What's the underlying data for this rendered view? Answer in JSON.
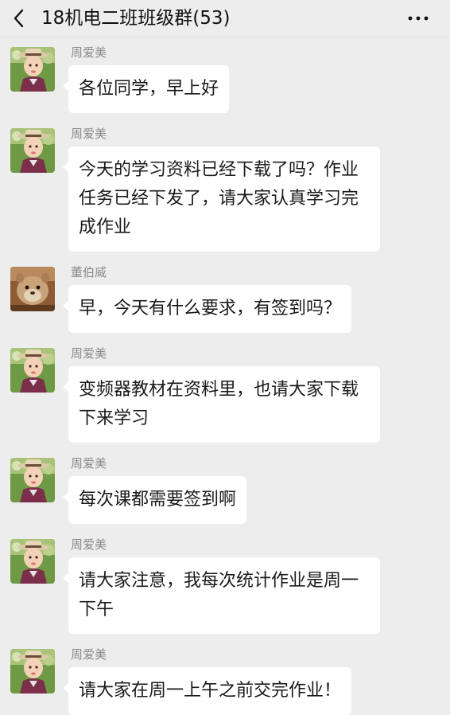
{
  "header": {
    "title": "18机电二班班级群(53)"
  },
  "messages": [
    {
      "sender": "周爱美",
      "avatar": "zhou-avatar",
      "text": "各位同学，早上好"
    },
    {
      "sender": "周爱美",
      "avatar": "zhou-avatar",
      "text": "今天的学习资料已经下载了吗？作业任务已经下发了，请大家认真学习完成作业"
    },
    {
      "sender": "董伯威",
      "avatar": "dong-avatar",
      "text": "早，今天有什么要求，有签到吗？"
    },
    {
      "sender": "周爱美",
      "avatar": "zhou-avatar",
      "text": "变频器教材在资料里，也请大家下载下来学习"
    },
    {
      "sender": "周爱美",
      "avatar": "zhou-avatar",
      "text": "每次课都需要签到啊"
    },
    {
      "sender": "周爱美",
      "avatar": "zhou-avatar",
      "text": "请大家注意，我每次统计作业是周一下午"
    },
    {
      "sender": "周爱美",
      "avatar": "zhou-avatar",
      "text": "请大家在周一上午之前交完作业！"
    }
  ],
  "colors": {
    "background": "#ededed",
    "bubble": "#ffffff",
    "sender_name": "#8a8a8a"
  }
}
